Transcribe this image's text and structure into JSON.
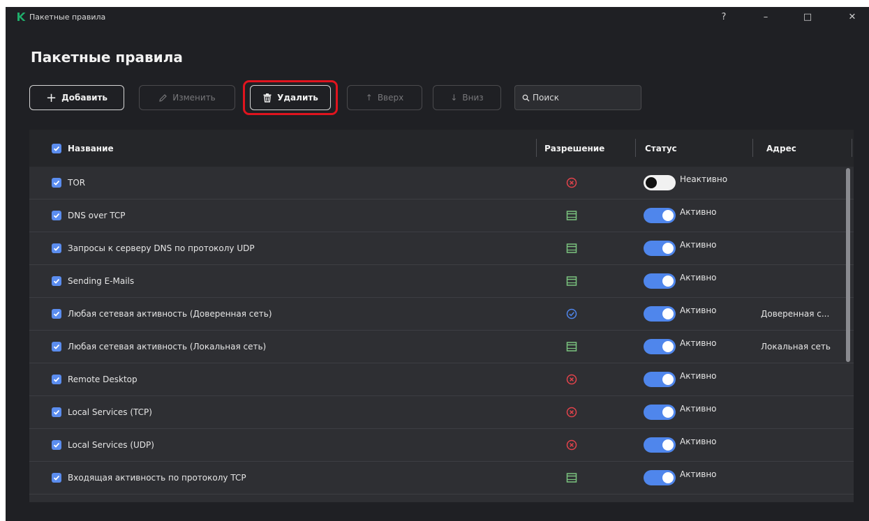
{
  "window": {
    "title": "Пакетные правила",
    "help_label": "?",
    "minimize_label": "–",
    "maximize_label": "□",
    "close_label": "✕",
    "logo_icon": "kaspersky-logo"
  },
  "page": {
    "title": "Пакетные правила"
  },
  "toolbar": {
    "add_label": "Добавить",
    "edit_label": "Изменить",
    "delete_label": "Удалить",
    "up_label": "Вверх",
    "down_label": "Вниз",
    "search_placeholder": "Поиск",
    "highlight_color": "#e0141e"
  },
  "table": {
    "columns": {
      "name": "Название",
      "permission": "Разрешение",
      "status": "Статус",
      "address": "Адрес"
    },
    "rows": [
      {
        "name": "TOR",
        "permission": "block",
        "active": false,
        "status": "Неактивно",
        "address": ""
      },
      {
        "name": "DNS over TCP",
        "permission": "rule",
        "active": true,
        "status": "Активно",
        "address": ""
      },
      {
        "name": "Запросы к серверу DNS по протоколу UDP",
        "permission": "rule",
        "active": true,
        "status": "Активно",
        "address": ""
      },
      {
        "name": "Sending E-Mails",
        "permission": "rule",
        "active": true,
        "status": "Активно",
        "address": ""
      },
      {
        "name": "Любая сетевая активность (Доверенная сеть)",
        "permission": "allow",
        "active": true,
        "status": "Активно",
        "address": "Доверенная с..."
      },
      {
        "name": "Любая сетевая активность (Локальная сеть)",
        "permission": "rule",
        "active": true,
        "status": "Активно",
        "address": "Локальная сеть"
      },
      {
        "name": "Remote Desktop",
        "permission": "block",
        "active": true,
        "status": "Активно",
        "address": ""
      },
      {
        "name": "Local Services (TCP)",
        "permission": "block",
        "active": true,
        "status": "Активно",
        "address": ""
      },
      {
        "name": "Local Services (UDP)",
        "permission": "block",
        "active": true,
        "status": "Активно",
        "address": ""
      },
      {
        "name": "Входящая активность по протоколу TCP",
        "permission": "rule",
        "active": true,
        "status": "Активно",
        "address": ""
      }
    ]
  },
  "colors": {
    "block": "#e2434b",
    "rule": "#7bc47f",
    "allow": "#4f86ec",
    "toggle_on": "#4f86ec"
  }
}
